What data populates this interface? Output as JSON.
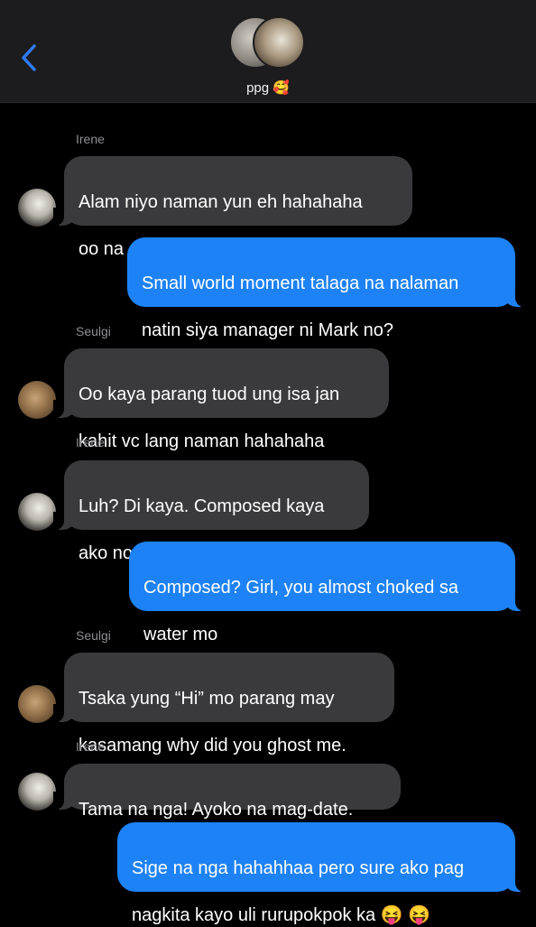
{
  "header": {
    "group_name": "ppg 🥰",
    "back_icon": "chevron-left-icon",
    "accent": "#2f7cf6"
  },
  "messages": [
    {
      "sender": "Irene",
      "direction": "in",
      "lines": [
        "Alam niyo naman yun eh hahahaha",
        "oo na oo kaso biglang nawala"
      ]
    },
    {
      "direction": "out",
      "lines": [
        "Small world moment talaga na nalaman",
        "natin siya manager ni Mark no?"
      ]
    },
    {
      "sender": "Seulgi",
      "direction": "in",
      "lines": [
        "Oo kaya parang tuod ung isa jan",
        "kahit vc lang naman hahahaha"
      ]
    },
    {
      "sender": "Irene",
      "direction": "in",
      "lines": [
        "Luh? Di kaya. Composed kaya",
        "ako non"
      ]
    },
    {
      "direction": "out",
      "lines": [
        "Composed? Girl, you almost choked sa",
        "water mo"
      ]
    },
    {
      "sender": "Seulgi",
      "direction": "in",
      "lines": [
        "Tsaka yung “Hi” mo parang may",
        "kasamang why did you ghost me."
      ]
    },
    {
      "sender": "Irene",
      "direction": "in",
      "lines": [
        "Tama na nga! Ayoko na mag-date."
      ]
    },
    {
      "direction": "out",
      "lines": [
        "Sige na nga hahahhaa pero sure ako pag",
        "nagkita kayo uli rurupokpok ka 😝 😝"
      ]
    }
  ],
  "colors": {
    "incoming_bubble": "#3a3a3c",
    "outgoing_bubble": "#1d82f5",
    "background": "#000000",
    "header": "#1c1c1e"
  }
}
